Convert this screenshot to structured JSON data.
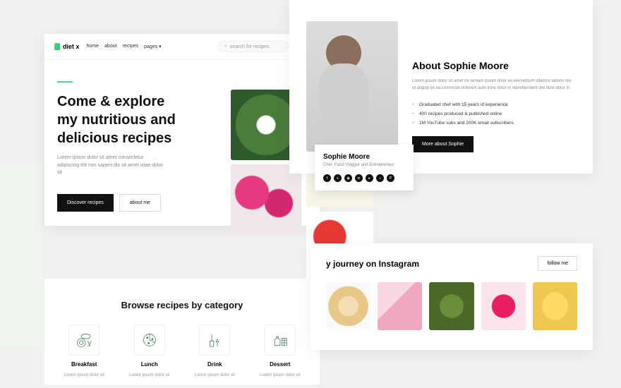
{
  "brand": "diet x",
  "nav": {
    "home": "home",
    "about": "about",
    "recipes": "recipes",
    "pages": "pages"
  },
  "search": {
    "placeholder": "search for recipes"
  },
  "hero": {
    "title": "Come & explore my nutritious and delicious recipes",
    "subtitle": "Lorem ipsum dolor sit amet consectetur adipiscing elit non sapien dis sit amet vitae dolor sit",
    "discover": "Discover recipes",
    "aboutme": "about me"
  },
  "browse": {
    "title": "Browse recipes by category",
    "items": [
      {
        "label": "Breakfast",
        "sub": "Lorem ipsum dolor sit"
      },
      {
        "label": "Lunch",
        "sub": "Lorem ipsum dolor sit"
      },
      {
        "label": "Drink",
        "sub": "Lorem ipsum dolor sit"
      },
      {
        "label": "Dessert",
        "sub": "Lorem ipsum dolor sit"
      }
    ]
  },
  "profile": {
    "name": "Sophie Moore",
    "role": "Chef, Food Vlogger and Entrepreneur"
  },
  "about": {
    "title": "About Sophie Moore",
    "text": "Lorem ipsum dolor sit amet mi veniam ipsum dolor ex elementum ullamco laboris nisi ut aliquip ex ea commodo dolorem aute irure dolor in reprehenderit vite iture dolor in",
    "bullets": [
      "Graduated chef with 15 years of experience",
      "400 recipes produced & published online",
      "1M YouTube subs and 200K email subscribers"
    ],
    "cta": "More about Sophie"
  },
  "instagram": {
    "title": "y journey on Instagram",
    "follow": "follow me"
  }
}
